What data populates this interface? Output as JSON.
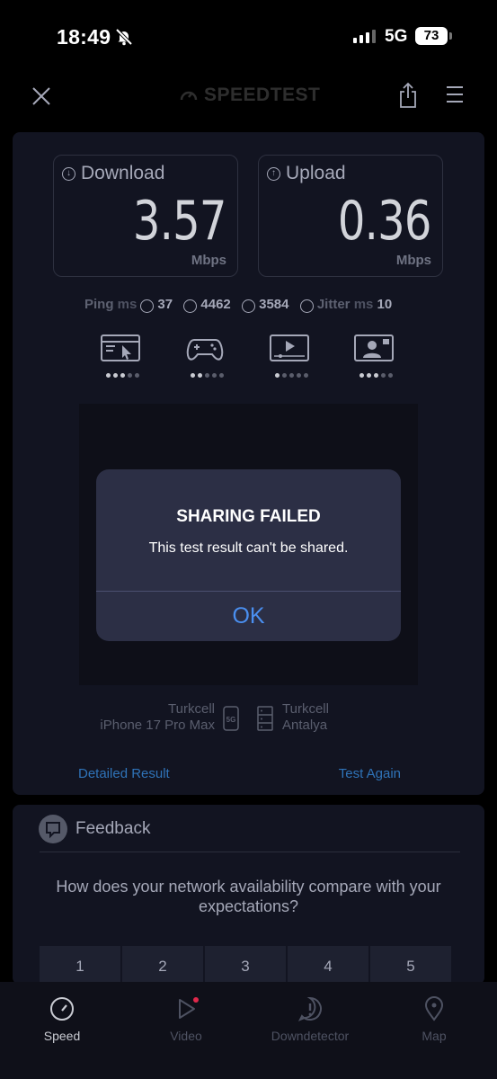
{
  "status_bar": {
    "time": "18:49",
    "network": "5G",
    "battery": "73"
  },
  "header": {
    "logo_text": "SPEEDTEST"
  },
  "results": {
    "download": {
      "label": "Download",
      "value": "3.57",
      "unit": "Mbps"
    },
    "upload": {
      "label": "Upload",
      "value": "0.36",
      "unit": "Mbps"
    },
    "ping_label": "Ping",
    "ms_label": "ms",
    "ping_value": "37",
    "download_latency": "4462",
    "upload_latency": "3584",
    "jitter_label": "Jitter",
    "jitter_value": "10"
  },
  "usage_ratings": [
    {
      "icon": "web-browsing-icon",
      "level": 3,
      "max": 5
    },
    {
      "icon": "gaming-icon",
      "level": 2,
      "max": 5
    },
    {
      "icon": "video-streaming-icon",
      "level": 1,
      "max": 5
    },
    {
      "icon": "video-call-icon",
      "level": 3,
      "max": 5
    }
  ],
  "connection": {
    "device_provider": "Turkcell",
    "device": "iPhone 17 Pro Max",
    "device_badge": "5G",
    "server_provider": "Turkcell",
    "server_city": "Antalya"
  },
  "links": {
    "detailed_result": "Detailed Result",
    "test_again": "Test Again"
  },
  "feedback": {
    "title": "Feedback",
    "question": "How does your network availability compare with your expectations?",
    "options": [
      "1",
      "2",
      "3",
      "4",
      "5"
    ]
  },
  "tabs": [
    {
      "label": "Speed",
      "icon": "speedometer-icon",
      "active": true
    },
    {
      "label": "Video",
      "icon": "play-icon",
      "active": false
    },
    {
      "label": "Downdetector",
      "icon": "alert-icon",
      "active": false
    },
    {
      "label": "Map",
      "icon": "map-pin-icon",
      "active": false
    }
  ],
  "dialog": {
    "title": "SHARING FAILED",
    "message": "This test result can't be shared.",
    "ok_label": "OK"
  },
  "colors": {
    "accent_link": "#2f73b8",
    "dialog_button": "#4a8ff0",
    "notification_dot": "#e0284b"
  }
}
